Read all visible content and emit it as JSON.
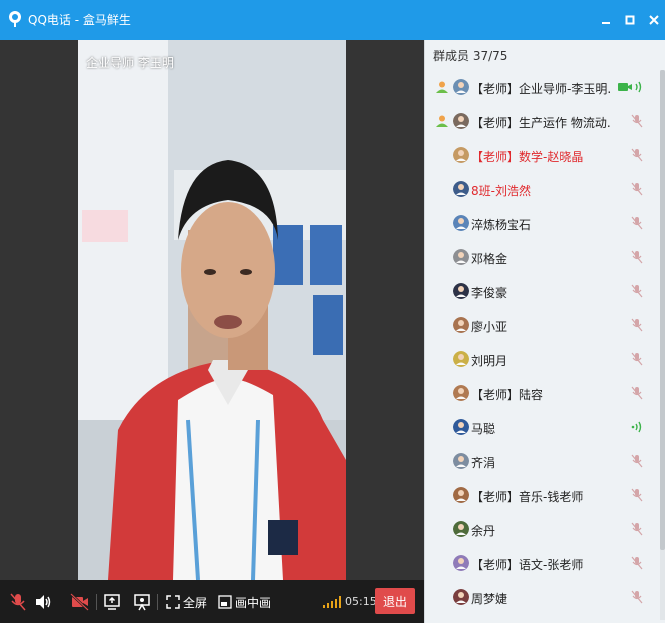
{
  "window": {
    "title": "QQ电话 - 盒马鲜生",
    "accent": "#1f9ae8"
  },
  "video": {
    "caller_name": "企业导师 李玉明"
  },
  "toolbar": {
    "fullscreen_label": "全屏",
    "pip_label": "画中画",
    "timer": "05:15",
    "exit_label": "退出",
    "exit_color": "#e04b4b"
  },
  "members": {
    "header": "群成员 37/75",
    "items": [
      {
        "name": "【老师】企业导师-李玉明...",
        "red": false,
        "role": "admin-icon",
        "status": "camera-speaking"
      },
      {
        "name": "【老师】生产运作 物流动...",
        "red": false,
        "role": "admin-icon",
        "status": "muted"
      },
      {
        "name": "【老师】数学-赵晓晶",
        "red": true,
        "role": "",
        "status": "muted"
      },
      {
        "name": "8班-刘浩然",
        "red": true,
        "role": "",
        "status": "muted"
      },
      {
        "name": "淬炼杨宝石",
        "red": false,
        "role": "",
        "status": "muted"
      },
      {
        "name": "邓格金",
        "red": false,
        "role": "",
        "status": "muted"
      },
      {
        "name": "李俊豪",
        "red": false,
        "role": "",
        "status": "muted"
      },
      {
        "name": "廖小亚",
        "red": false,
        "role": "",
        "status": "muted"
      },
      {
        "name": "刘明月",
        "red": false,
        "role": "",
        "status": "muted"
      },
      {
        "name": "【老师】陆容",
        "red": false,
        "role": "",
        "status": "muted"
      },
      {
        "name": "马聪",
        "red": false,
        "role": "",
        "status": "speaking"
      },
      {
        "name": "齐涓",
        "red": false,
        "role": "",
        "status": "muted"
      },
      {
        "name": "【老师】音乐-钱老师",
        "red": false,
        "role": "",
        "status": "muted"
      },
      {
        "name": "余丹",
        "red": false,
        "role": "",
        "status": "muted"
      },
      {
        "name": "【老师】语文-张老师",
        "red": false,
        "role": "",
        "status": "muted"
      },
      {
        "name": "周梦婕",
        "red": false,
        "role": "",
        "status": "muted"
      }
    ]
  }
}
